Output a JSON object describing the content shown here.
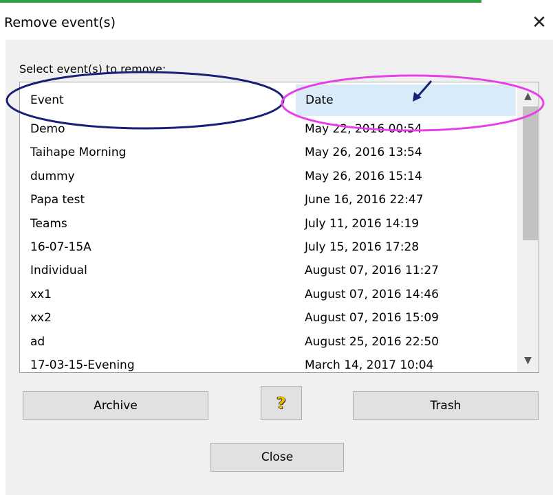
{
  "window": {
    "title": "Remove event(s)",
    "close_glyph": "✕"
  },
  "prompt": "Select event(s) to remove:",
  "list": {
    "columns": [
      "Event",
      "Date"
    ],
    "rows": [
      {
        "event": "Demo",
        "date": "May 22, 2016 00:54"
      },
      {
        "event": "Taihape Morning",
        "date": "May 26, 2016 13:54"
      },
      {
        "event": "dummy",
        "date": "May 26, 2016 15:14"
      },
      {
        "event": "Papa test",
        "date": "June 16, 2016 22:47"
      },
      {
        "event": "Teams",
        "date": "July 11, 2016 14:19"
      },
      {
        "event": "16-07-15A",
        "date": "July 15, 2016 17:28"
      },
      {
        "event": "Individual",
        "date": "August 07, 2016 11:27"
      },
      {
        "event": "xx1",
        "date": "August 07, 2016 14:46"
      },
      {
        "event": "xx2",
        "date": "August 07, 2016 15:09"
      },
      {
        "event": "ad",
        "date": "August 25, 2016 22:50"
      },
      {
        "event": "17-03-15-Evening",
        "date": "March 14, 2017 10:04"
      }
    ],
    "scroll_up_glyph": "▲",
    "scroll_down_glyph": "▼"
  },
  "buttons": {
    "archive": "Archive",
    "help": "?",
    "trash": "Trash",
    "close": "Close"
  },
  "annotations": {
    "event_header_circle_color": "#1c1f78",
    "date_header_circle_color": "#e83ee8",
    "arrow_color": "#1c1f78"
  },
  "colors": {
    "window_bg": "#f0f0f0",
    "header_highlight": "#d9ebf9",
    "title_accent": "#2f9e44"
  }
}
